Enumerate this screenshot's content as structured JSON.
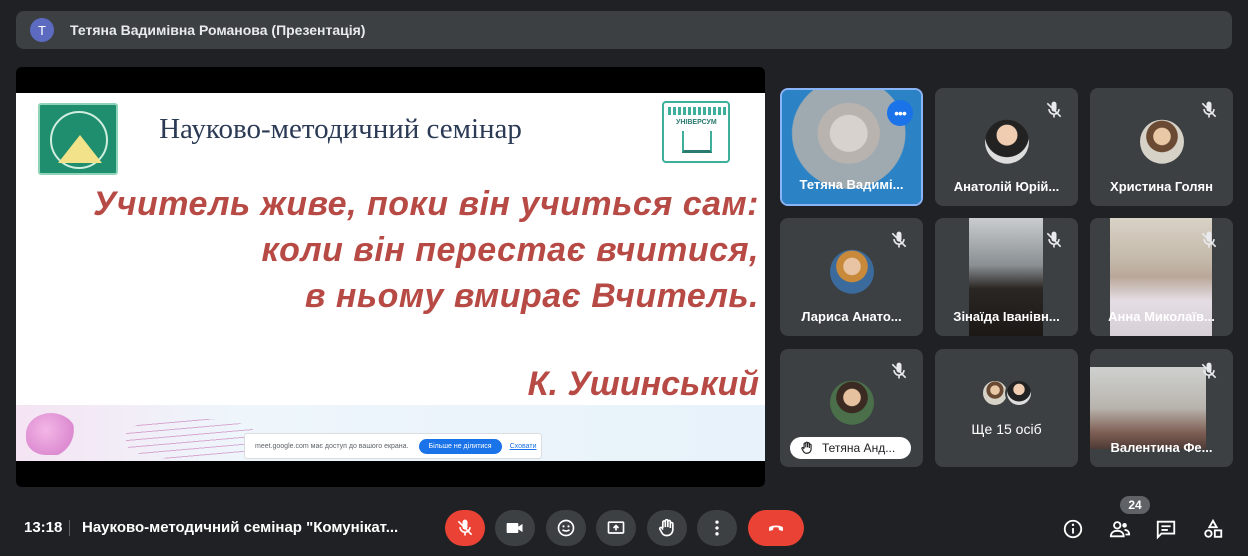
{
  "topbar": {
    "avatar_letter": "T",
    "presenter": "Тетяна Вадимівна Романова (Презентація)"
  },
  "slide": {
    "title": "Науково-методичний семінар",
    "quote_line1": "Учитель живе, поки він учиться сам:",
    "quote_line2": "коли він перестає вчитися,",
    "quote_line3": "в ньому вмирає Вчитель.",
    "author": "К. Ушинський",
    "logo_right_text": "УНІВЕРСУМ",
    "share_text": "meet.google.com має доступ до вашого екрана.",
    "share_stop": "Більше не ділитися",
    "share_hide": "Сховати"
  },
  "tiles": [
    {
      "name": "Тетяна Вадимі...",
      "muted": false
    },
    {
      "name": "Анатолій Юрій...",
      "muted": true
    },
    {
      "name": "Христина Голян",
      "muted": true
    },
    {
      "name": "Лариса Анато...",
      "muted": true
    },
    {
      "name": "Зінаїда Іванівн...",
      "muted": true
    },
    {
      "name": "Анна Миколаїв...",
      "muted": true
    },
    {
      "name": "Тетяна Анд...",
      "muted": true,
      "hand_raised": true
    },
    {
      "name": "Ще 15 осіб"
    },
    {
      "name": "Валентина Фе...",
      "muted": true
    }
  ],
  "bottombar": {
    "time": "13:18",
    "meeting_title": "Науково-методичний семінар \"Комунікат...",
    "participants_count": "24"
  },
  "colors": {
    "accent": "#1a73e8",
    "danger": "#ea4335",
    "surface": "#3c4043",
    "background": "#202124"
  }
}
